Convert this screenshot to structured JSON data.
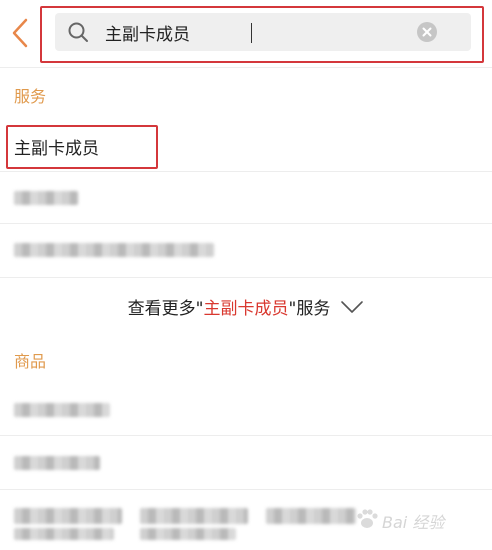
{
  "search": {
    "value": "主副卡成员",
    "placeholder": ""
  },
  "sections": {
    "services_title": "服务",
    "goods_title": "商品"
  },
  "service_results": [
    {
      "label": "主副卡成员"
    }
  ],
  "see_more": {
    "prefix": "查看更多\"",
    "keyword": "主副卡成员",
    "suffix": "\"服务"
  },
  "watermark": {
    "text": "Bai 经验"
  },
  "colors": {
    "accent_orange": "#e09a4d",
    "keyword_red": "#d9382f",
    "annotation_red": "#d4373b"
  },
  "icons": [
    "back-arrow-icon",
    "search-icon",
    "clear-icon",
    "chevron-down-icon",
    "paw-logo-icon"
  ]
}
